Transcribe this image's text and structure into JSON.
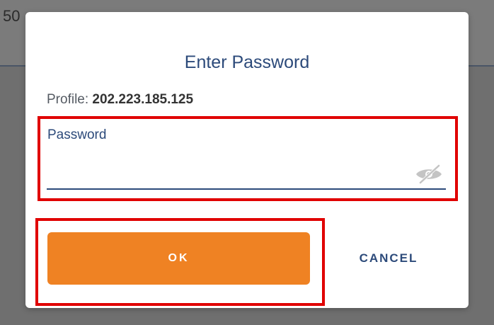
{
  "background": {
    "partial_text": "50"
  },
  "dialog": {
    "title": "Enter Password",
    "profile_label": "Profile:",
    "profile_value": "202.223.185.125",
    "password_label": "Password",
    "password_value": "",
    "eye_icon": "eye-slash-icon",
    "ok_label": "OK",
    "cancel_label": "CANCEL"
  },
  "colors": {
    "accent_orange": "#ef8223",
    "title_blue": "#2c4a7a",
    "highlight_red": "#e00000",
    "backdrop": "#6f6f6f"
  }
}
